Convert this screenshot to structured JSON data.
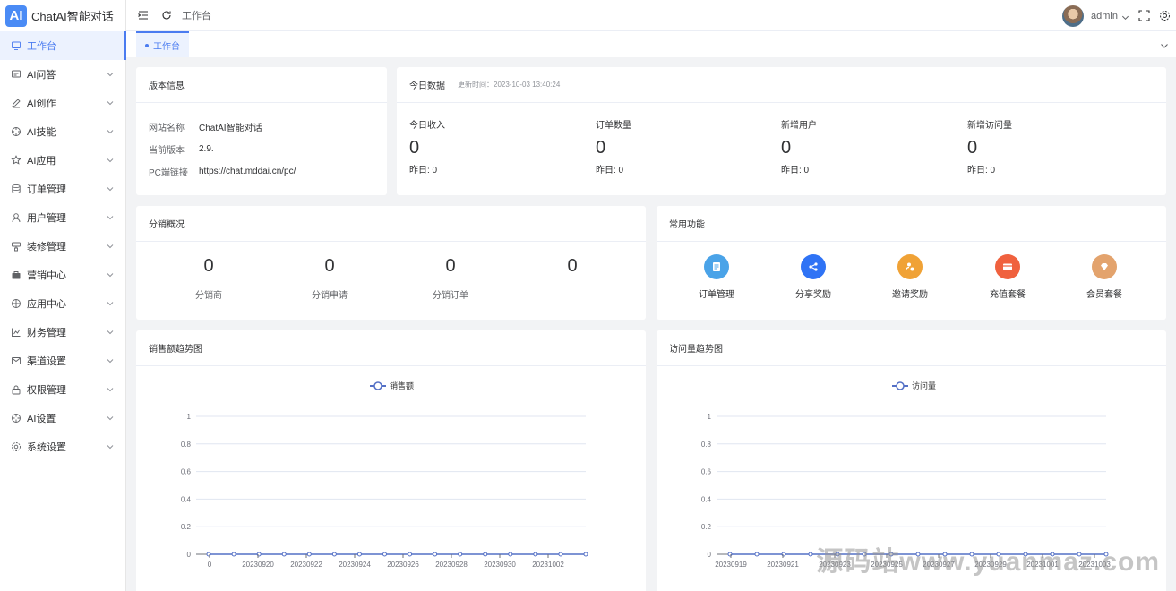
{
  "app": {
    "logo_text": "AI",
    "title": "ChatAI智能对话"
  },
  "sidebar": {
    "items": [
      {
        "label": "工作台",
        "icon": "monitor-icon",
        "active": true
      },
      {
        "label": "AI问答",
        "icon": "chat-icon"
      },
      {
        "label": "AI创作",
        "icon": "pen-icon"
      },
      {
        "label": "AI技能",
        "icon": "target-icon"
      },
      {
        "label": "AI应用",
        "icon": "star-icon"
      },
      {
        "label": "订单管理",
        "icon": "database-icon"
      },
      {
        "label": "用户管理",
        "icon": "user-icon"
      },
      {
        "label": "装修管理",
        "icon": "brush-icon"
      },
      {
        "label": "营销中心",
        "icon": "bag-icon"
      },
      {
        "label": "应用中心",
        "icon": "apps-icon"
      },
      {
        "label": "财务管理",
        "icon": "chart-icon"
      },
      {
        "label": "渠道设置",
        "icon": "mail-icon"
      },
      {
        "label": "权限管理",
        "icon": "lock-icon"
      },
      {
        "label": "AI设置",
        "icon": "settings-circle-icon"
      },
      {
        "label": "系统设置",
        "icon": "gear-icon"
      }
    ]
  },
  "header": {
    "breadcrumb": "工作台",
    "user": "admin"
  },
  "tabs": [
    {
      "label": "工作台"
    }
  ],
  "version": {
    "title": "版本信息",
    "rows": [
      {
        "k": "网站名称",
        "v": "ChatAI智能对话"
      },
      {
        "k": "当前版本",
        "v": "2.9."
      },
      {
        "k": "PC端链接",
        "v": "https://chat.mddai.cn/pc/"
      }
    ]
  },
  "today": {
    "title": "今日数据",
    "updated": "更新时间：2023-10-03 13:40:24",
    "stats": [
      {
        "label": "今日收入",
        "value": "0",
        "yesterday": "昨日: 0"
      },
      {
        "label": "订单数量",
        "value": "0",
        "yesterday": "昨日: 0"
      },
      {
        "label": "新增用户",
        "value": "0",
        "yesterday": "昨日: 0"
      },
      {
        "label": "新增访问量",
        "value": "0",
        "yesterday": "昨日: 0"
      }
    ]
  },
  "distribution": {
    "title": "分销概况",
    "items": [
      {
        "value": "0",
        "label": "分销商"
      },
      {
        "value": "0",
        "label": "分销申请"
      },
      {
        "value": "0",
        "label": "分销订单"
      },
      {
        "value": "0",
        "label": ""
      }
    ]
  },
  "functions": {
    "title": "常用功能",
    "items": [
      {
        "label": "订单管理",
        "icon": "order-icon",
        "color": "#4aa3e8"
      },
      {
        "label": "分享奖励",
        "icon": "share-icon",
        "color": "#2f73f5"
      },
      {
        "label": "邀请奖励",
        "icon": "invite-icon",
        "color": "#f0a236"
      },
      {
        "label": "充值套餐",
        "icon": "card-icon",
        "color": "#f0613e"
      },
      {
        "label": "会员套餐",
        "icon": "diamond-icon",
        "color": "#e3a36d"
      }
    ]
  },
  "chart_data": [
    {
      "type": "line",
      "title": "销售额趋势图",
      "series": [
        {
          "name": "销售额",
          "values": [
            0,
            0,
            0,
            0,
            0,
            0,
            0,
            0,
            0,
            0,
            0,
            0,
            0,
            0,
            0,
            0
          ]
        }
      ],
      "x_tick_labels": [
        "0",
        "20230920",
        "20230922",
        "20230924",
        "20230926",
        "20230928",
        "20230930",
        "20231002"
      ],
      "y_ticks": [
        "0",
        "0.2",
        "0.4",
        "0.6",
        "0.8",
        "1"
      ],
      "ylim": [
        0,
        1
      ],
      "legend": "top-center",
      "color": "#5470c6"
    },
    {
      "type": "line",
      "title": "访问量趋势图",
      "series": [
        {
          "name": "访问量",
          "values": [
            0,
            0,
            0,
            0,
            0,
            0,
            0,
            0,
            0,
            0,
            0,
            0,
            0,
            0,
            0
          ]
        }
      ],
      "x_tick_labels": [
        "20230919",
        "20230921",
        "20230923",
        "20230925",
        "20230927",
        "20230929",
        "20231001",
        "20231003"
      ],
      "y_ticks": [
        "0",
        "0.2",
        "0.4",
        "0.6",
        "0.8",
        "1"
      ],
      "ylim": [
        0,
        1
      ],
      "legend": "top-center",
      "color": "#5470c6"
    }
  ],
  "watermark": "源码站www.yuanmaz.com"
}
